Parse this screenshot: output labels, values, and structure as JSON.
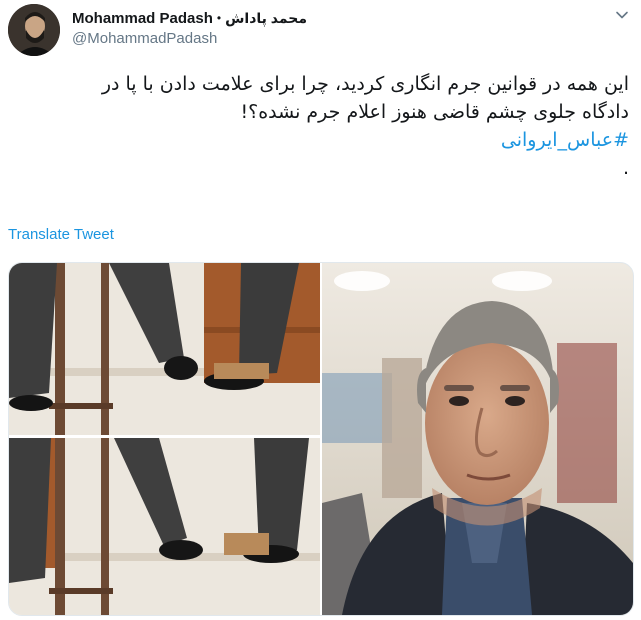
{
  "tweet": {
    "display_name": "Mohammad Padash",
    "separator": "•",
    "alt_name": "محمد پاداش",
    "handle": "@MohammadPadash",
    "text_lines": [
      "این همه در قوانین جرم انگاری کردید، چرا برای علامت دادن با پا در",
      "دادگاه جلوی چشم قاضی هنوز اعلام جرم نشده؟!"
    ],
    "hashtag": "#عباس_ایروانی",
    "trailing": ".",
    "translate_label": "Translate Tweet"
  },
  "icons": {
    "caret": "chevron-down-icon",
    "avatar": "profile-avatar"
  },
  "colors": {
    "link": "#1b95e0",
    "text": "#14171a",
    "muted": "#657786",
    "border": "#e1e8ed"
  }
}
